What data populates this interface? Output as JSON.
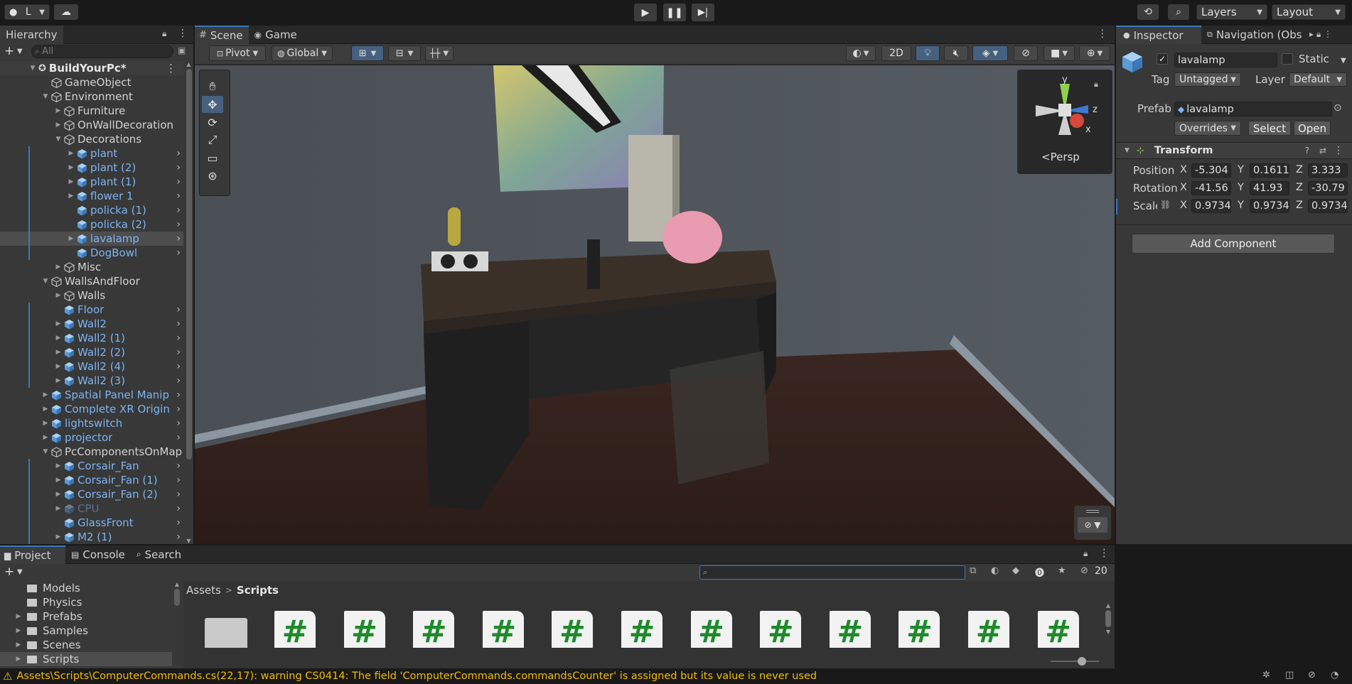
{
  "toolbar": {
    "account_label": "L",
    "layers_label": "Layers",
    "layout_label": "Layout"
  },
  "hierarchy": {
    "tab": "Hierarchy",
    "search_placeholder": "All",
    "scene_name": "BuildYourPc*",
    "items": [
      {
        "label": "GameObject",
        "depth": 1,
        "arrow": "",
        "prefab": false
      },
      {
        "label": "Environment",
        "depth": 1,
        "arrow": "down",
        "prefab": false
      },
      {
        "label": "Furniture",
        "depth": 2,
        "arrow": "right",
        "prefab": false
      },
      {
        "label": "OnWallDecoration",
        "depth": 2,
        "arrow": "right",
        "prefab": false
      },
      {
        "label": "Decorations",
        "depth": 2,
        "arrow": "down",
        "prefab": false
      },
      {
        "label": "plant",
        "depth": 3,
        "arrow": "right",
        "prefab": true
      },
      {
        "label": "plant (2)",
        "depth": 3,
        "arrow": "right",
        "prefab": true
      },
      {
        "label": "plant (1)",
        "depth": 3,
        "arrow": "right",
        "prefab": true
      },
      {
        "label": "flower 1",
        "depth": 3,
        "arrow": "right",
        "prefab": true
      },
      {
        "label": "policka (1)",
        "depth": 3,
        "arrow": "",
        "prefab": true
      },
      {
        "label": "policka (2)",
        "depth": 3,
        "arrow": "",
        "prefab": true
      },
      {
        "label": "lavalamp",
        "depth": 3,
        "arrow": "right",
        "prefab": true,
        "selected": true
      },
      {
        "label": "DogBowl",
        "depth": 3,
        "arrow": "",
        "prefab": true
      },
      {
        "label": "Misc",
        "depth": 2,
        "arrow": "right",
        "prefab": false
      },
      {
        "label": "WallsAndFloor",
        "depth": 1,
        "arrow": "down",
        "prefab": false
      },
      {
        "label": "Walls",
        "depth": 2,
        "arrow": "right",
        "prefab": false
      },
      {
        "label": "Floor",
        "depth": 2,
        "arrow": "",
        "prefab": true
      },
      {
        "label": "Wall2",
        "depth": 2,
        "arrow": "right",
        "prefab": true
      },
      {
        "label": "Wall2 (1)",
        "depth": 2,
        "arrow": "right",
        "prefab": true
      },
      {
        "label": "Wall2 (2)",
        "depth": 2,
        "arrow": "right",
        "prefab": true
      },
      {
        "label": "Wall2 (4)",
        "depth": 2,
        "arrow": "right",
        "prefab": true
      },
      {
        "label": "Wall2 (3)",
        "depth": 2,
        "arrow": "right",
        "prefab": true
      },
      {
        "label": "Spatial Panel Manip",
        "depth": 1,
        "arrow": "right",
        "prefab": true
      },
      {
        "label": "Complete XR Origin",
        "depth": 1,
        "arrow": "right",
        "prefab": true
      },
      {
        "label": "lightswitch",
        "depth": 1,
        "arrow": "right",
        "prefab": true
      },
      {
        "label": "projector",
        "depth": 1,
        "arrow": "right",
        "prefab": true
      },
      {
        "label": "PcComponentsOnMap",
        "depth": 1,
        "arrow": "down",
        "prefab": false
      },
      {
        "label": "Corsair_Fan",
        "depth": 2,
        "arrow": "right",
        "prefab": true
      },
      {
        "label": "Corsair_Fan (1)",
        "depth": 2,
        "arrow": "right",
        "prefab": true
      },
      {
        "label": "Corsair_Fan (2)",
        "depth": 2,
        "arrow": "right",
        "prefab": true
      },
      {
        "label": "CPU",
        "depth": 2,
        "arrow": "right",
        "prefab": true,
        "disabled": true
      },
      {
        "label": "GlassFront",
        "depth": 2,
        "arrow": "",
        "prefab": true
      },
      {
        "label": "M2 (1)",
        "depth": 2,
        "arrow": "right",
        "prefab": true
      }
    ]
  },
  "scene": {
    "tabs": [
      "Scene",
      "Game"
    ],
    "pivot_label": "Pivot",
    "global_label": "Global",
    "mode_2d": "2D",
    "persp_label": "Persp",
    "gizmo_axes": {
      "y": "y",
      "z": "z",
      "x": "x"
    }
  },
  "inspector": {
    "tab": "Inspector",
    "tab2": "Navigation (Obs",
    "object_name": "lavalamp",
    "static_label": "Static",
    "tag_label": "Tag",
    "tag_value": "Untagged",
    "layer_label": "Layer",
    "layer_value": "Default",
    "prefab_label": "Prefab",
    "prefab_value": "lavalamp",
    "overrides_label": "Overrides",
    "select_label": "Select",
    "open_label": "Open",
    "transform_title": "Transform",
    "position_label": "Position",
    "rotation_label": "Rotation",
    "scale_label": "Scale",
    "axis_x": "X",
    "axis_y": "Y",
    "axis_z": "Z",
    "position": {
      "x": "-5.304",
      "y": "0.1611",
      "z": "3.333"
    },
    "rotation": {
      "x": "-41.56",
      "y": "41.93",
      "z": "-30.79"
    },
    "scale": {
      "x": "0.9734",
      "y": "0.9734",
      "z": "0.9734"
    },
    "add_component_label": "Add Component"
  },
  "project": {
    "tabs": [
      "Project",
      "Console",
      "Search"
    ],
    "folders": [
      "Models",
      "Physics",
      "Prefabs",
      "Samples",
      "Scenes",
      "Scripts"
    ],
    "breadcrumb_root": "Assets",
    "breadcrumb_current": "Scripts",
    "hidden_count": "20",
    "script_count": 12
  },
  "status": {
    "message": "Assets\\Scripts\\ComputerCommands.cs(22,17): warning CS0414: The field 'ComputerCommands.commandsCounter' is assigned but its value is never used",
    "warning_color": "#f4bc02"
  }
}
